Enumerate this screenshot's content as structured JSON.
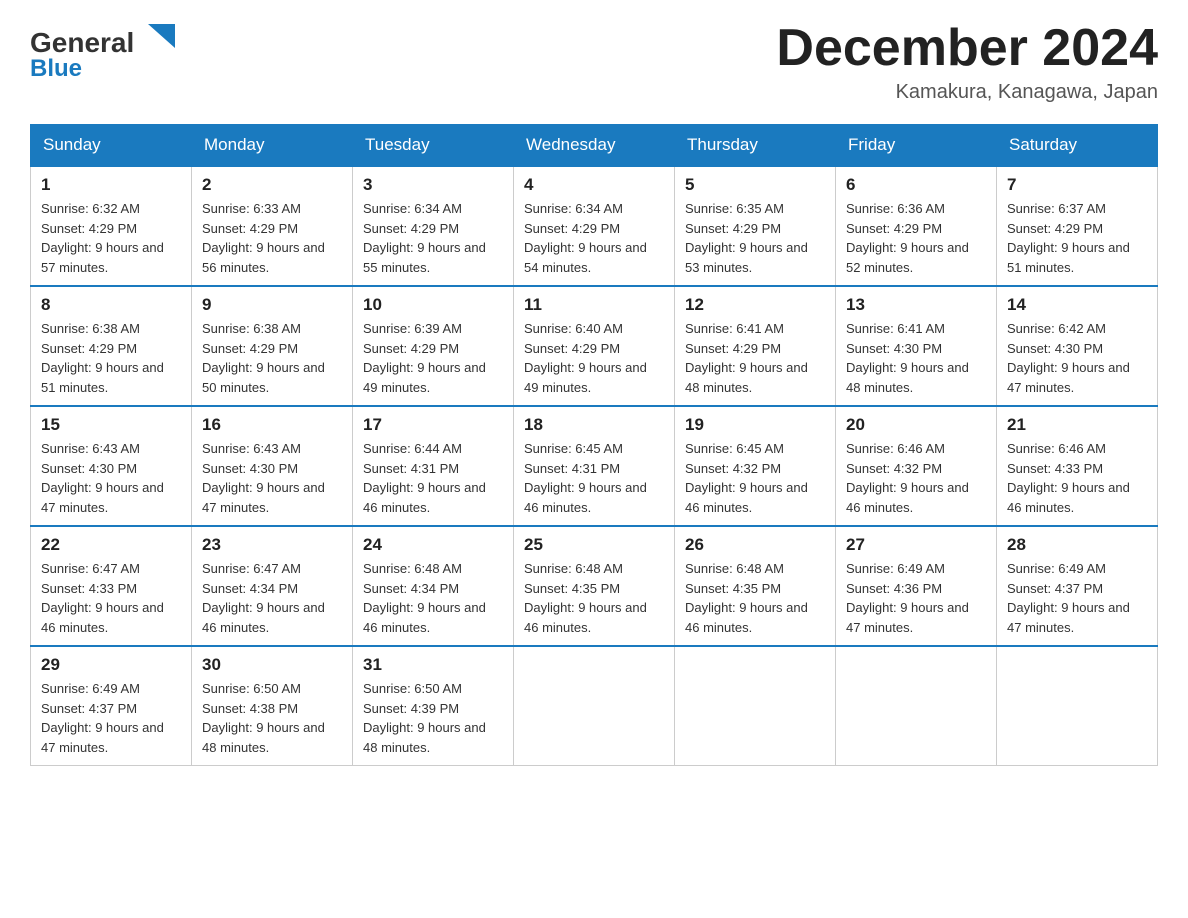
{
  "header": {
    "logo": {
      "text_general": "General",
      "text_blue": "Blue"
    },
    "title": "December 2024",
    "location": "Kamakura, Kanagawa, Japan"
  },
  "weekdays": [
    "Sunday",
    "Monday",
    "Tuesday",
    "Wednesday",
    "Thursday",
    "Friday",
    "Saturday"
  ],
  "weeks": [
    [
      {
        "day": "1",
        "sunrise": "6:32 AM",
        "sunset": "4:29 PM",
        "daylight": "9 hours and 57 minutes."
      },
      {
        "day": "2",
        "sunrise": "6:33 AM",
        "sunset": "4:29 PM",
        "daylight": "9 hours and 56 minutes."
      },
      {
        "day": "3",
        "sunrise": "6:34 AM",
        "sunset": "4:29 PM",
        "daylight": "9 hours and 55 minutes."
      },
      {
        "day": "4",
        "sunrise": "6:34 AM",
        "sunset": "4:29 PM",
        "daylight": "9 hours and 54 minutes."
      },
      {
        "day": "5",
        "sunrise": "6:35 AM",
        "sunset": "4:29 PM",
        "daylight": "9 hours and 53 minutes."
      },
      {
        "day": "6",
        "sunrise": "6:36 AM",
        "sunset": "4:29 PM",
        "daylight": "9 hours and 52 minutes."
      },
      {
        "day": "7",
        "sunrise": "6:37 AM",
        "sunset": "4:29 PM",
        "daylight": "9 hours and 51 minutes."
      }
    ],
    [
      {
        "day": "8",
        "sunrise": "6:38 AM",
        "sunset": "4:29 PM",
        "daylight": "9 hours and 51 minutes."
      },
      {
        "day": "9",
        "sunrise": "6:38 AM",
        "sunset": "4:29 PM",
        "daylight": "9 hours and 50 minutes."
      },
      {
        "day": "10",
        "sunrise": "6:39 AM",
        "sunset": "4:29 PM",
        "daylight": "9 hours and 49 minutes."
      },
      {
        "day": "11",
        "sunrise": "6:40 AM",
        "sunset": "4:29 PM",
        "daylight": "9 hours and 49 minutes."
      },
      {
        "day": "12",
        "sunrise": "6:41 AM",
        "sunset": "4:29 PM",
        "daylight": "9 hours and 48 minutes."
      },
      {
        "day": "13",
        "sunrise": "6:41 AM",
        "sunset": "4:30 PM",
        "daylight": "9 hours and 48 minutes."
      },
      {
        "day": "14",
        "sunrise": "6:42 AM",
        "sunset": "4:30 PM",
        "daylight": "9 hours and 47 minutes."
      }
    ],
    [
      {
        "day": "15",
        "sunrise": "6:43 AM",
        "sunset": "4:30 PM",
        "daylight": "9 hours and 47 minutes."
      },
      {
        "day": "16",
        "sunrise": "6:43 AM",
        "sunset": "4:30 PM",
        "daylight": "9 hours and 47 minutes."
      },
      {
        "day": "17",
        "sunrise": "6:44 AM",
        "sunset": "4:31 PM",
        "daylight": "9 hours and 46 minutes."
      },
      {
        "day": "18",
        "sunrise": "6:45 AM",
        "sunset": "4:31 PM",
        "daylight": "9 hours and 46 minutes."
      },
      {
        "day": "19",
        "sunrise": "6:45 AM",
        "sunset": "4:32 PM",
        "daylight": "9 hours and 46 minutes."
      },
      {
        "day": "20",
        "sunrise": "6:46 AM",
        "sunset": "4:32 PM",
        "daylight": "9 hours and 46 minutes."
      },
      {
        "day": "21",
        "sunrise": "6:46 AM",
        "sunset": "4:33 PM",
        "daylight": "9 hours and 46 minutes."
      }
    ],
    [
      {
        "day": "22",
        "sunrise": "6:47 AM",
        "sunset": "4:33 PM",
        "daylight": "9 hours and 46 minutes."
      },
      {
        "day": "23",
        "sunrise": "6:47 AM",
        "sunset": "4:34 PM",
        "daylight": "9 hours and 46 minutes."
      },
      {
        "day": "24",
        "sunrise": "6:48 AM",
        "sunset": "4:34 PM",
        "daylight": "9 hours and 46 minutes."
      },
      {
        "day": "25",
        "sunrise": "6:48 AM",
        "sunset": "4:35 PM",
        "daylight": "9 hours and 46 minutes."
      },
      {
        "day": "26",
        "sunrise": "6:48 AM",
        "sunset": "4:35 PM",
        "daylight": "9 hours and 46 minutes."
      },
      {
        "day": "27",
        "sunrise": "6:49 AM",
        "sunset": "4:36 PM",
        "daylight": "9 hours and 47 minutes."
      },
      {
        "day": "28",
        "sunrise": "6:49 AM",
        "sunset": "4:37 PM",
        "daylight": "9 hours and 47 minutes."
      }
    ],
    [
      {
        "day": "29",
        "sunrise": "6:49 AM",
        "sunset": "4:37 PM",
        "daylight": "9 hours and 47 minutes."
      },
      {
        "day": "30",
        "sunrise": "6:50 AM",
        "sunset": "4:38 PM",
        "daylight": "9 hours and 48 minutes."
      },
      {
        "day": "31",
        "sunrise": "6:50 AM",
        "sunset": "4:39 PM",
        "daylight": "9 hours and 48 minutes."
      },
      null,
      null,
      null,
      null
    ]
  ]
}
